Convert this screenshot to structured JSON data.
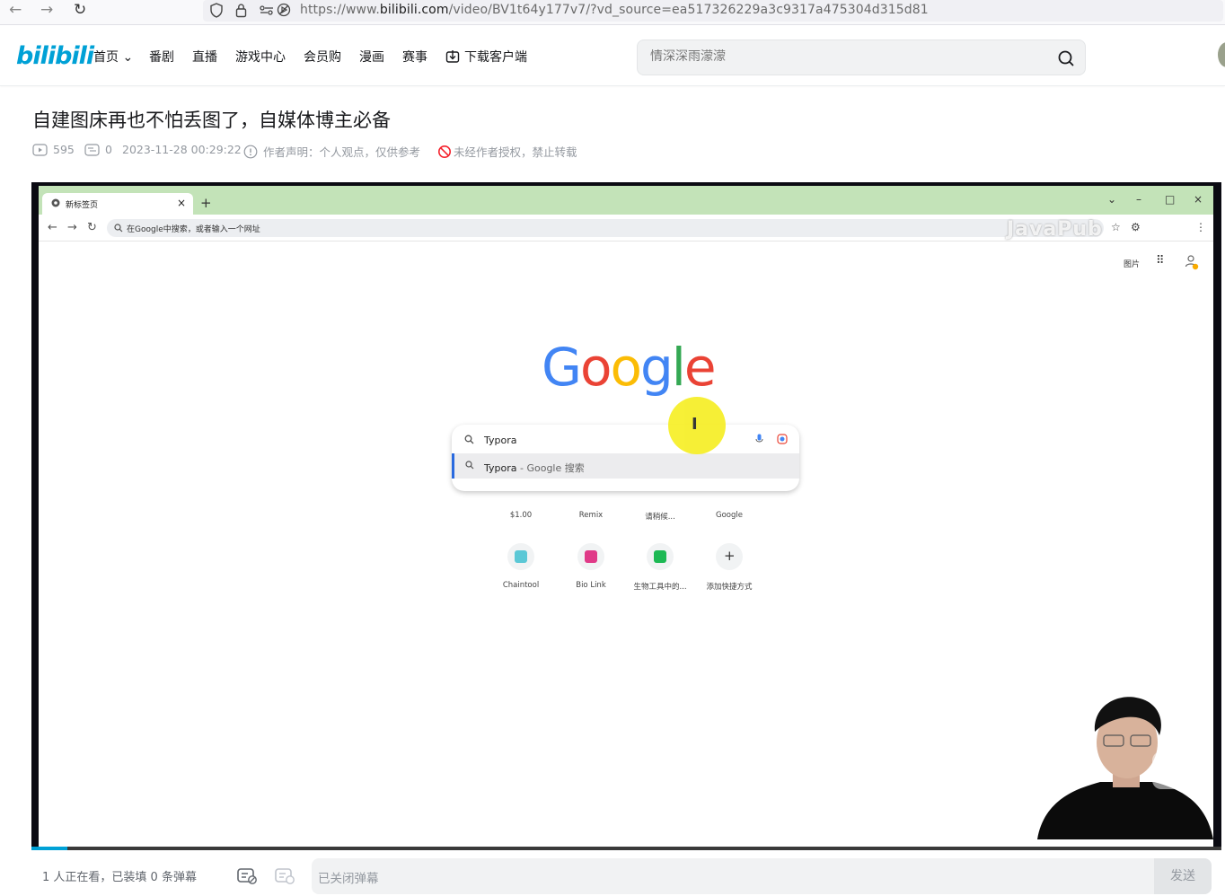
{
  "browser": {
    "url_prefix": "https://www.",
    "url_domain": "bilibili.com",
    "url_rest": "/video/BV1t64y177v7/?vd_source=ea517326229a3c9317a475304d315d81",
    "back_icon": "←",
    "forward_icon": "→",
    "reload_icon": "↻"
  },
  "header": {
    "logo_text": "bilibili",
    "nav": [
      {
        "label": "首页 ⌄"
      },
      {
        "label": "番剧"
      },
      {
        "label": "直播"
      },
      {
        "label": "游戏中心"
      },
      {
        "label": "会员购"
      },
      {
        "label": "漫画"
      },
      {
        "label": "赛事"
      },
      {
        "label": "下载客户端"
      }
    ],
    "search_placeholder": "情深深雨濛濛"
  },
  "video": {
    "title": "自建图床再也不怕丢图了，自媒体博主必备",
    "plays": "595",
    "danmaku_count": "0",
    "date": "2023-11-28 00:29:22",
    "statement": "作者声明：个人观点，仅供参考",
    "copyright": "未经作者授权，禁止转载",
    "progress": 0.03
  },
  "player_content": {
    "tab_title": "新标签页",
    "tab_close": "×",
    "tab_new": "+",
    "win_min": "–",
    "win_max": "□",
    "win_close": "×",
    "win_down": "⌄",
    "omni_placeholder": "在Google中搜索，或者输入一个网址",
    "watermark": "JavaPub",
    "images_link": "图片",
    "google_logo": [
      "G",
      "o",
      "o",
      "g",
      "l",
      "e"
    ],
    "google_colors": [
      "#4285f4",
      "#ea4335",
      "#fbbc05",
      "#4285f4",
      "#34a853",
      "#ea4335"
    ],
    "query": "Typora",
    "suggest_main": "Typora",
    "suggest_rest": " - Google 搜索",
    "cursor_glyph": "I",
    "shortcuts_row1": [
      "$1.00",
      "Remix",
      "请稍候...",
      "Google"
    ],
    "shortcuts_row2": [
      "Chaintool",
      "Bio Link",
      "生物工具中的...",
      "添加快捷方式"
    ]
  },
  "danmaku": {
    "viewers": "1 人正在看，已装填 0 条弹幕",
    "input_placeholder": "已关闭弹幕",
    "send_label": "发送"
  }
}
